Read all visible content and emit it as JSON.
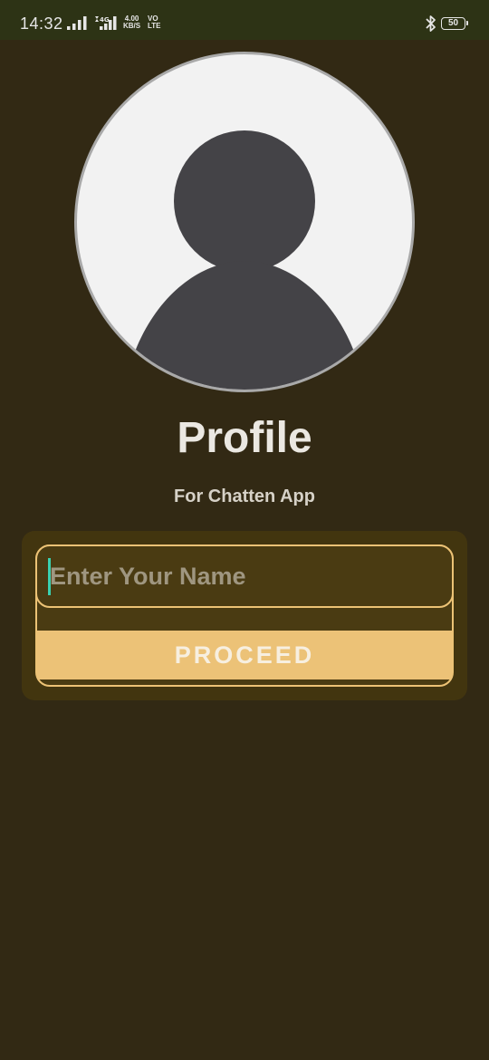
{
  "status_bar": {
    "time": "14:32",
    "net_speed_value": "4.00",
    "net_speed_unit": "KB/S",
    "volte_line1": "VO",
    "volte_line2": "LTE",
    "battery_level": "50"
  },
  "profile": {
    "title": "Profile",
    "subtitle": "For Chatten App"
  },
  "form": {
    "name_placeholder": "Enter Your Name",
    "name_value": "",
    "proceed_label": "PROCEED"
  },
  "colors": {
    "background": "#322914",
    "status_bar": "#2d3315",
    "card": "#42350f",
    "accent": "#ecc277",
    "caret": "#3ad1b0",
    "avatar_silhouette": "#444347"
  }
}
